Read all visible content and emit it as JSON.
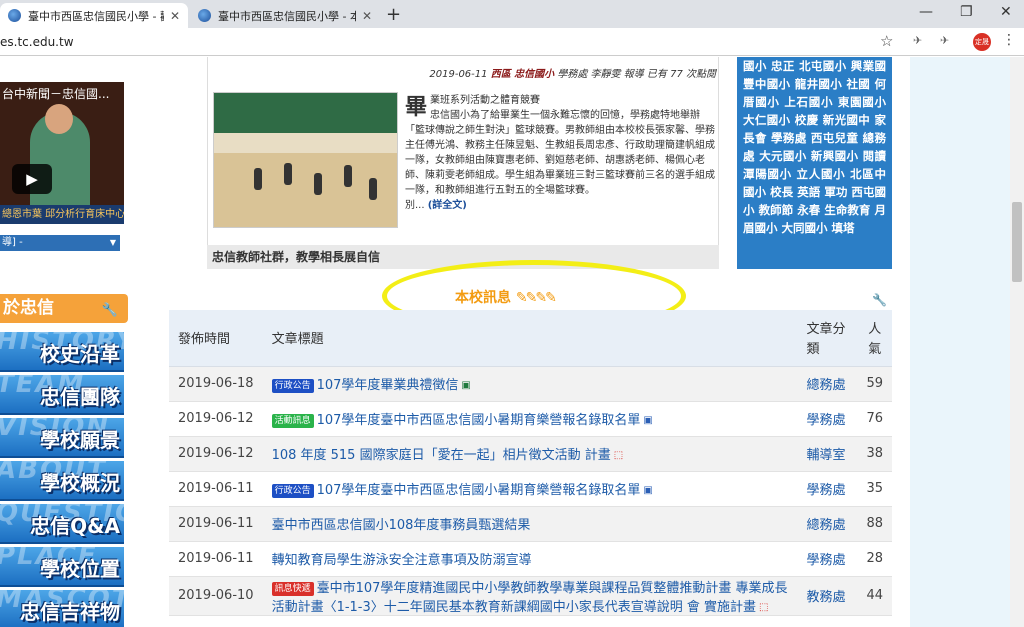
{
  "browser": {
    "tabs": [
      {
        "title": "臺中市西區忠信國民小學 - 歡迎光",
        "active": true
      },
      {
        "title": "臺中市西區忠信國民小學 - 本站資",
        "active": false
      }
    ],
    "new_tab": "+",
    "url": "es.tc.edu.tw",
    "avatar": "定晟"
  },
  "left": {
    "video_title": "台中新聞－忠信國...",
    "video_caption": "總恩市葉 邱分析行育床中心",
    "select_text": "導] -",
    "section_header": "於忠信",
    "nav": [
      {
        "label": "校史沿革",
        "ghost": "HISTORY"
      },
      {
        "label": "忠信團隊",
        "ghost": "TEAM"
      },
      {
        "label": "學校願景",
        "ghost": "VISION"
      },
      {
        "label": "學校概況",
        "ghost": "ABOUT"
      },
      {
        "label": "忠信Q&A",
        "ghost": "QUESTION"
      },
      {
        "label": "學校位置",
        "ghost": "PLACE"
      },
      {
        "label": "忠信吉祥物",
        "ghost": "MASCOT"
      }
    ]
  },
  "news": {
    "meta_date": "2019-06-11",
    "meta_org": "西區 忠信國小",
    "meta_rest": "學務處 李靜雯 報導 已有 77 次點閱",
    "drop_cap": "畢",
    "headline": "業班系列活動之體育競賽",
    "body": "忠信國小為了給畢業生一個永難忘懷的回憶，學務處特地舉辦「籃球傳說之師生對決」籃球競賽。男教師組由本校校長張家馨、學務主任傅光鴻、教務主任陳昱魁、生教組長周忠彥、行政助理簡建帆組成一隊，女教師組由陳寶惠老師、劉姮慈老師、胡惠誘老師、楊佩心老師、陳莉雯老師組成。學生組為畢業班三對三籃球賽前三名的選手組成一隊，和教師組進行五對五的全場籃球賽。",
    "more_prefix": "別...",
    "more_label": "(詳全文)",
    "footer": "忠信教師社群，教學相長展自信"
  },
  "tag_cloud": "國小 忠正 北屯國小 興業國 豐中國小 龍井國小 社國 何厝國小 上石國小 東園國小 大仁國小 校慶 新光國中 家長會 學務處 西屯兒童 總務處 大元國小 新興國小 閱讀 潭陽國小 立人國小 北區中國小 校長 英語 軍功 西屯國小 教師節 永春 生命教育 月眉國小 大同國小 填塔",
  "section": {
    "title": "本校訊息",
    "pencils": "✎✎✎✎"
  },
  "table": {
    "headers": {
      "date": "發佈時間",
      "title": "文章標題",
      "category": "文章分類",
      "popularity": "人氣"
    },
    "rows": [
      {
        "date": "2019-06-18",
        "badge": "行政公告",
        "badge_color": "blue",
        "title": "107學年度畢業典禮徵信",
        "file": "xls",
        "category": "總務處",
        "popularity": "59"
      },
      {
        "date": "2019-06-12",
        "badge": "活動訊息",
        "badge_color": "green",
        "title": "107學年度臺中市西區忠信國小暑期育樂營報名錄取名單",
        "file": "doc",
        "category": "學務處",
        "popularity": "76"
      },
      {
        "date": "2019-06-12",
        "badge": "",
        "badge_color": "",
        "title": "108 年度 515 國際家庭日「愛在一起」相片徵文活動 計畫",
        "file": "pdf",
        "category": "輔導室",
        "popularity": "38"
      },
      {
        "date": "2019-06-11",
        "badge": "行政公告",
        "badge_color": "blue",
        "title": "107學年度臺中市西區忠信國小暑期育樂營報名錄取名單",
        "file": "doc",
        "category": "學務處",
        "popularity": "35"
      },
      {
        "date": "2019-06-11",
        "badge": "",
        "badge_color": "",
        "title": "臺中市西區忠信國小108年度事務員甄選結果",
        "file": "",
        "category": "總務處",
        "popularity": "88"
      },
      {
        "date": "2019-06-11",
        "badge": "",
        "badge_color": "",
        "title": "轉知教育局學生游泳安全注意事項及防溺宣導",
        "file": "",
        "category": "學務處",
        "popularity": "28"
      },
      {
        "date": "2019-06-10",
        "badge": "訊息快遞",
        "badge_color": "red",
        "title": "臺中市107學年度精進國民中小學教師教學專業與課程品質整體推動計畫 專業成長活動計畫〈1-1-3〉十二年國民基本教育新課綱國中小家長代表宣導說明 會 實施計畫",
        "file": "pdf",
        "category": "教務處",
        "popularity": "44"
      }
    ]
  }
}
